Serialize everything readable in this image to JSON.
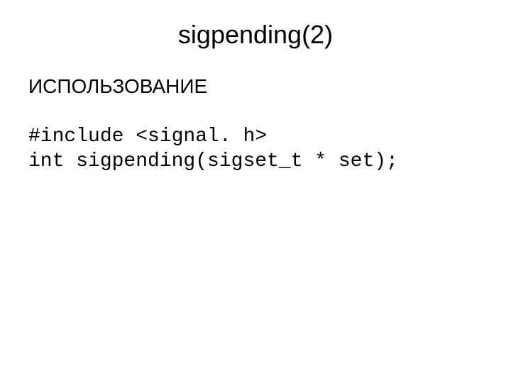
{
  "slide": {
    "title": "sigpending(2)",
    "section_heading": "ИСПОЛЬЗОВАНИЕ",
    "code_line1": "#include <signal. h>",
    "code_line2": "int sigpending(sigset_t * set);"
  }
}
